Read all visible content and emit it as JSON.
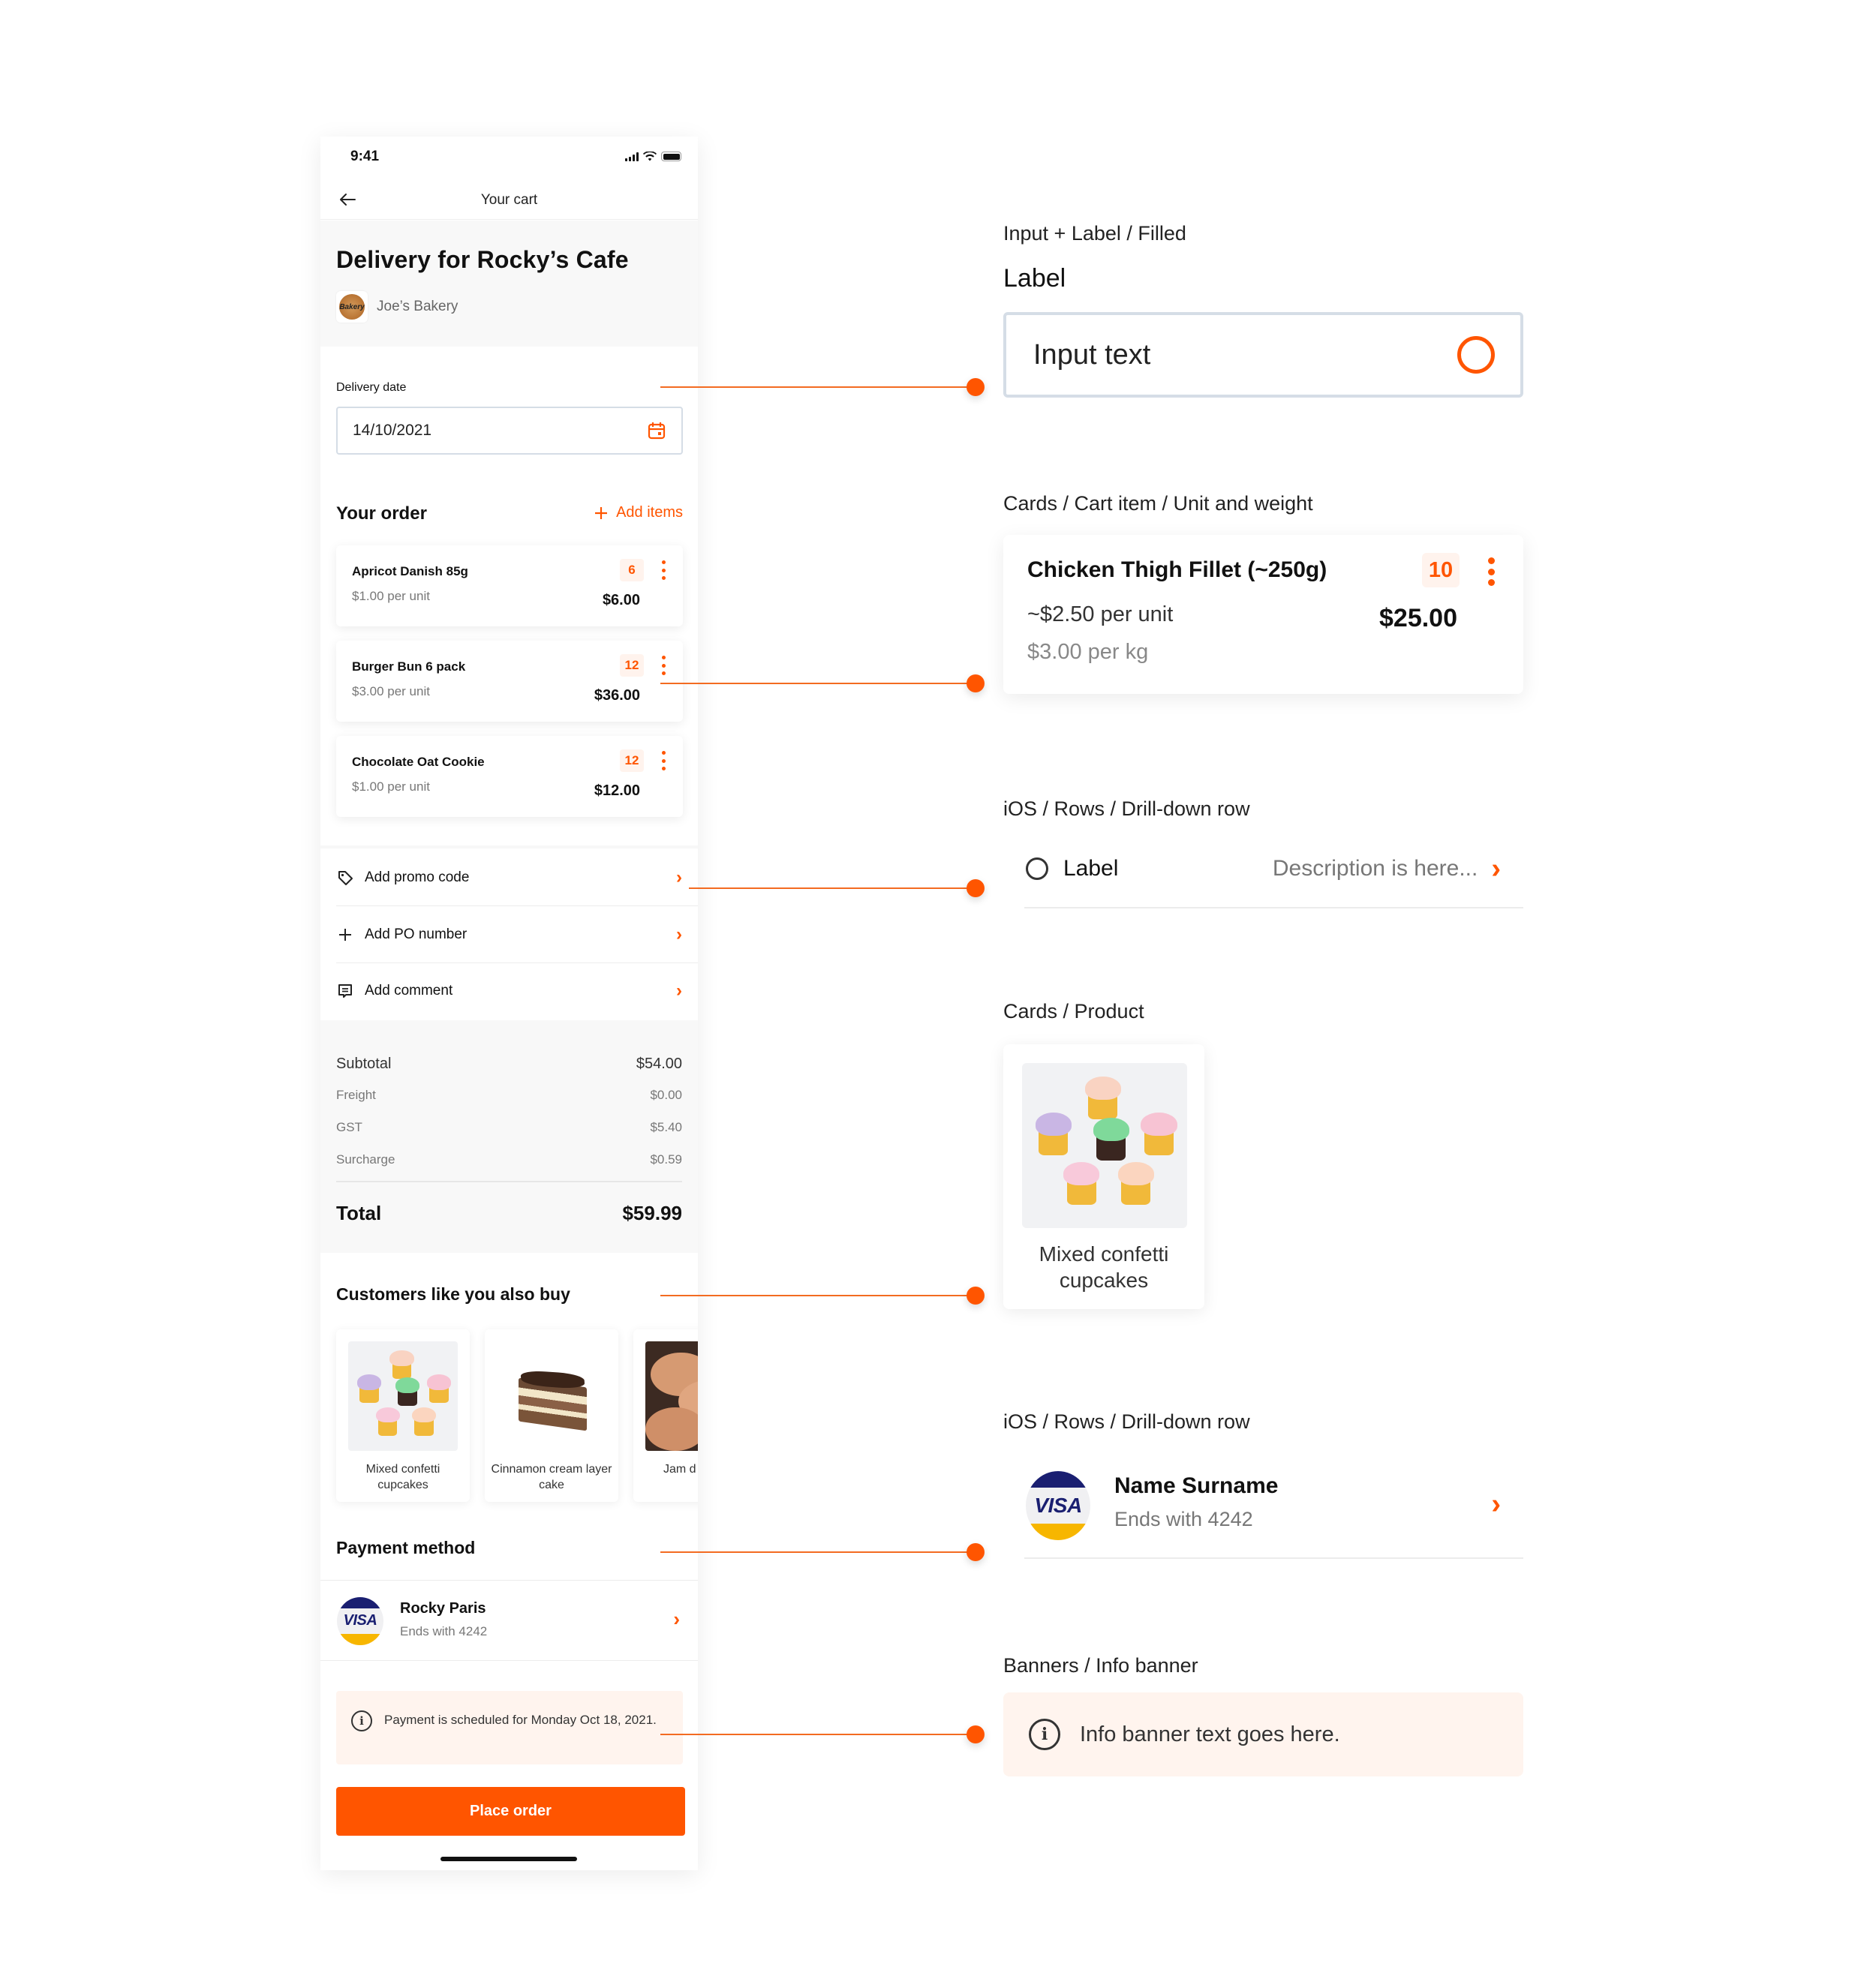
{
  "phone": {
    "status_bar": {
      "time": "9:41",
      "icons": [
        "cellular-signal-icon",
        "wifi-icon",
        "battery-icon"
      ]
    },
    "nav": {
      "title": "Your cart",
      "back_icon": "arrow-left-icon"
    },
    "header": {
      "title": "Delivery for Rocky’s Cafe",
      "supplier_name": "Joe’s Bakery",
      "supplier_logo_text": "Bakery"
    },
    "delivery": {
      "label": "Delivery date",
      "value": "14/10/2021",
      "icon": "calendar-icon"
    },
    "order": {
      "heading": "Your order",
      "add_items_label": "Add items",
      "items": [
        {
          "name": "Apricot Danish 85g",
          "unit_price": "$1.00 per unit",
          "qty": "6",
          "total": "$6.00"
        },
        {
          "name": "Burger Bun 6 pack",
          "unit_price": "$3.00 per unit",
          "qty": "12",
          "total": "$36.00"
        },
        {
          "name": "Chocolate Oat Cookie",
          "unit_price": "$1.00 per unit",
          "qty": "12",
          "total": "$12.00"
        }
      ]
    },
    "actions": [
      {
        "label": "Add promo code",
        "icon": "tag-icon"
      },
      {
        "label": "Add PO number",
        "icon": "plus-icon"
      },
      {
        "label": "Add comment",
        "icon": "comment-icon"
      }
    ],
    "summary": {
      "subtotal_label": "Subtotal",
      "subtotal": "$54.00",
      "freight_label": "Freight",
      "freight": "$0.00",
      "gst_label": "GST",
      "gst": "$5.40",
      "surcharge_label": "Surcharge",
      "surcharge": "$0.59",
      "total_label": "Total",
      "total": "$59.99"
    },
    "recommendations": {
      "heading": "Customers like you also buy",
      "products": [
        {
          "name": "Mixed confetti cupcakes"
        },
        {
          "name": "Cinnamon cream layer cake"
        },
        {
          "name": "Jam d"
        }
      ]
    },
    "payment": {
      "heading": "Payment method",
      "card_brand": "VISA",
      "name": "Rocky Paris",
      "ending": "Ends with 4242"
    },
    "banner": {
      "text": "Payment is scheduled for Monday Oct 18, 2021."
    },
    "cta": {
      "label": "Place order"
    }
  },
  "components": {
    "input": {
      "caption": "Input + Label / Filled",
      "label": "Label",
      "value": "Input text"
    },
    "cart_item": {
      "caption": "Cards / Cart item / Unit and weight",
      "name": "Chicken Thigh Fillet (~250g)",
      "unit_price": "~$2.50 per unit",
      "weight_price": "$3.00 per kg",
      "qty": "10",
      "total": "$25.00"
    },
    "drilldown_row": {
      "caption": "iOS / Rows / Drill-down row",
      "label": "Label",
      "description": "Description is here..."
    },
    "product_card": {
      "caption": "Cards / Product",
      "name": "Mixed confetti cupcakes"
    },
    "payment_row": {
      "caption": "iOS / Rows / Drill-down row",
      "card_brand": "VISA",
      "name": "Name Surname",
      "ending": "Ends with 4242"
    },
    "info_banner": {
      "caption": "Banners / Info banner",
      "text": "Info banner text goes here."
    }
  },
  "colors": {
    "accent": "#ff5500",
    "connector": "#f36b21",
    "banner_bg": "#fff4ee",
    "qty_bg": "#fff3ed",
    "visa_blue": "#1a1f71",
    "visa_gold": "#f7b600"
  }
}
